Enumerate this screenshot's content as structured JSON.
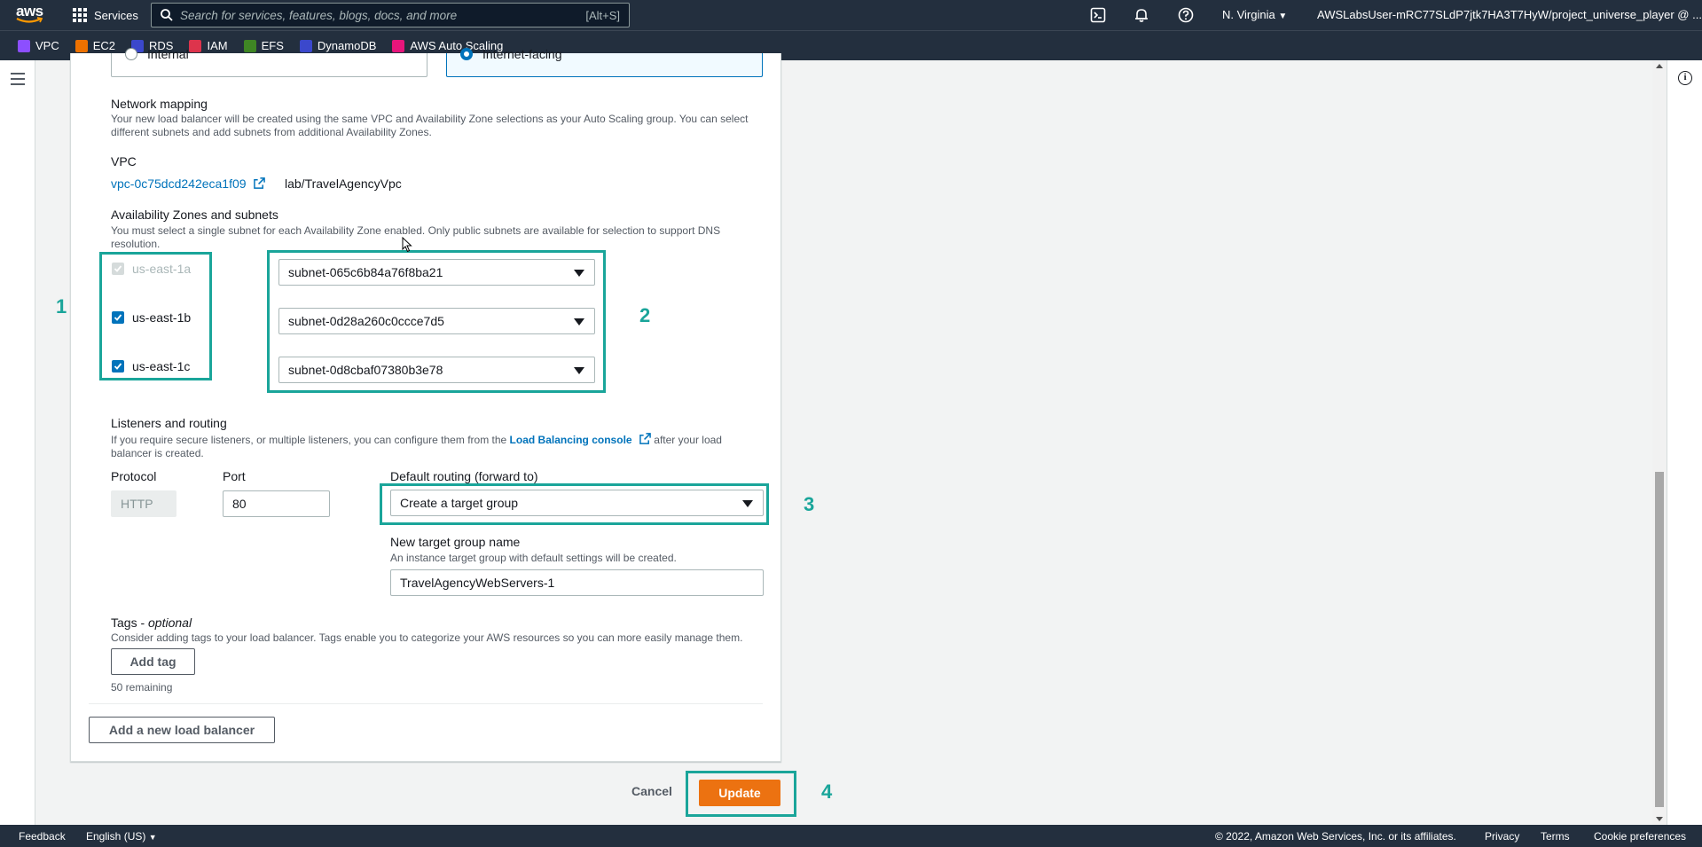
{
  "topnav": {
    "logo_text": "aws",
    "services_label": "Services",
    "search_placeholder": "Search for services, features, blogs, docs, and more",
    "search_shortcut": "[Alt+S]",
    "region": "N. Virginia",
    "account": "AWSLabsUser-mRC77SLdP7jtk7HA3T7HyW/project_universe_player @ ..."
  },
  "favorites": [
    {
      "label": "VPC",
      "color": "#8c4fff"
    },
    {
      "label": "EC2",
      "color": "#ed7100"
    },
    {
      "label": "RDS",
      "color": "#3b48cc"
    },
    {
      "label": "IAM",
      "color": "#dd344c"
    },
    {
      "label": "EFS",
      "color": "#3f8624"
    },
    {
      "label": "DynamoDB",
      "color": "#3b48cc"
    },
    {
      "label": "AWS Auto Scaling",
      "color": "#e7157b"
    }
  ],
  "scheme": {
    "internal_label": "Internal",
    "internet_facing_label": "Internet-facing"
  },
  "network": {
    "title": "Network mapping",
    "description": "Your new load balancer will be created using the same VPC and Availability Zone selections as your Auto Scaling group. You can select different subnets and add subnets from additional Availability Zones.",
    "vpc_label": "VPC",
    "vpc_id": "vpc-0c75dcd242eca1f09",
    "vpc_name": "lab/TravelAgencyVpc"
  },
  "azs": {
    "title": "Availability Zones and subnets",
    "description": "You must select a single subnet for each Availability Zone enabled. Only public subnets are available for selection to support DNS resolution.",
    "zones": [
      {
        "name": "us-east-1a",
        "checked": true,
        "disabled": true,
        "subnet": "subnet-065c6b84a76f8ba21"
      },
      {
        "name": "us-east-1b",
        "checked": true,
        "disabled": false,
        "subnet": "subnet-0d28a260c0ccce7d5"
      },
      {
        "name": "us-east-1c",
        "checked": true,
        "disabled": false,
        "subnet": "subnet-0d8cbaf07380b3e78"
      }
    ]
  },
  "listeners": {
    "title": "Listeners and routing",
    "desc_before": "If you require secure listeners, or multiple listeners, you can configure them from the",
    "desc_link": "Load Balancing console",
    "desc_after": "after your load balancer is created.",
    "protocol_label": "Protocol",
    "protocol_value": "HTTP",
    "port_label": "Port",
    "port_value": "80",
    "routing_label": "Default routing (forward to)",
    "routing_value": "Create a target group",
    "tg_name_label": "New target group name",
    "tg_name_desc": "An instance target group with default settings will be created.",
    "tg_name_value": "TravelAgencyWebServers-1"
  },
  "tags": {
    "title": "Tags - ",
    "title_optional": "optional",
    "description": "Consider adding tags to your load balancer. Tags enable you to categorize your AWS resources so you can more easily manage them.",
    "add_button": "Add tag",
    "remaining": "50 remaining"
  },
  "add_lb_button": "Add a new load balancer",
  "actions": {
    "cancel": "Cancel",
    "update": "Update"
  },
  "annotations": [
    "1",
    "2",
    "3",
    "4"
  ],
  "footer": {
    "feedback": "Feedback",
    "language": "English (US)",
    "copyright": "© 2022, Amazon Web Services, Inc. or its affiliates.",
    "privacy": "Privacy",
    "terms": "Terms",
    "cookies": "Cookie preferences"
  },
  "colors": {
    "nav_bg": "#232f3e",
    "link": "#0073bb",
    "primary": "#ec7211",
    "highlight": "#1aa59a"
  }
}
